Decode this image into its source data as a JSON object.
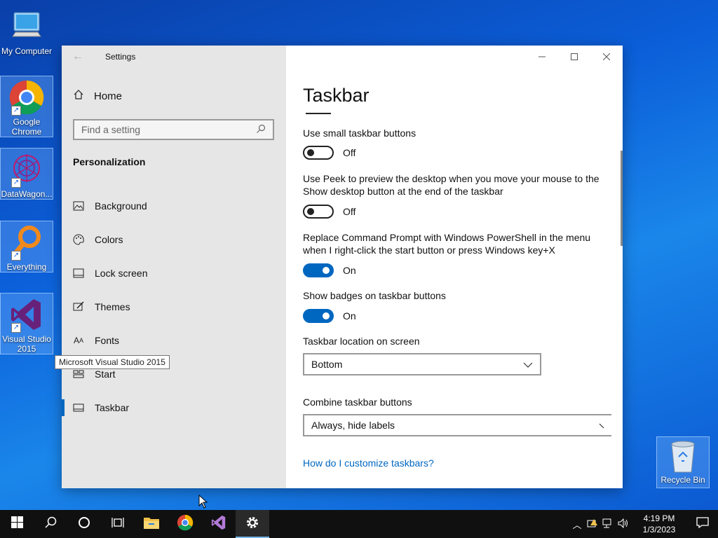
{
  "desktop": {
    "icons": [
      {
        "label": "My Computer"
      },
      {
        "label": "Google Chrome"
      },
      {
        "label": "DataWagon..."
      },
      {
        "label": "Everything"
      },
      {
        "label": "Visual Studio 2015"
      }
    ],
    "tooltip": "Microsoft Visual Studio 2015",
    "recycle_bin": "Recycle Bin"
  },
  "window": {
    "title": "Settings",
    "controls": {
      "minimize": "—",
      "maximize": "☐",
      "close": "✕"
    }
  },
  "sidebar": {
    "home": "Home",
    "search_placeholder": "Find a setting",
    "section": "Personalization",
    "items": [
      {
        "label": "Background",
        "icon": "image-icon"
      },
      {
        "label": "Colors",
        "icon": "palette-icon"
      },
      {
        "label": "Lock screen",
        "icon": "lock-screen-icon"
      },
      {
        "label": "Themes",
        "icon": "brush-icon"
      },
      {
        "label": "Fonts",
        "icon": "font-icon"
      },
      {
        "label": "Start",
        "icon": "start-icon"
      },
      {
        "label": "Taskbar",
        "icon": "taskbar-icon"
      }
    ]
  },
  "main": {
    "title": "Taskbar",
    "options": [
      {
        "label": "Use small taskbar buttons",
        "state": "Off"
      },
      {
        "label": "Use Peek to preview the desktop when you move your mouse to the Show desktop button at the end of the taskbar",
        "state": "Off"
      },
      {
        "label": "Replace Command Prompt with Windows PowerShell in the menu when I right-click the start button or press Windows key+X",
        "state": "On"
      },
      {
        "label": "Show badges on taskbar buttons",
        "state": "On"
      }
    ],
    "location_label": "Taskbar location on screen",
    "location_value": "Bottom",
    "combine_label": "Combine taskbar buttons",
    "combine_value": "Always, hide labels",
    "help_link": "How do I customize taskbars?"
  },
  "taskbar": {
    "time": "4:19 PM",
    "date": "1/3/2023"
  },
  "colors": {
    "accent": "#0067c0"
  }
}
